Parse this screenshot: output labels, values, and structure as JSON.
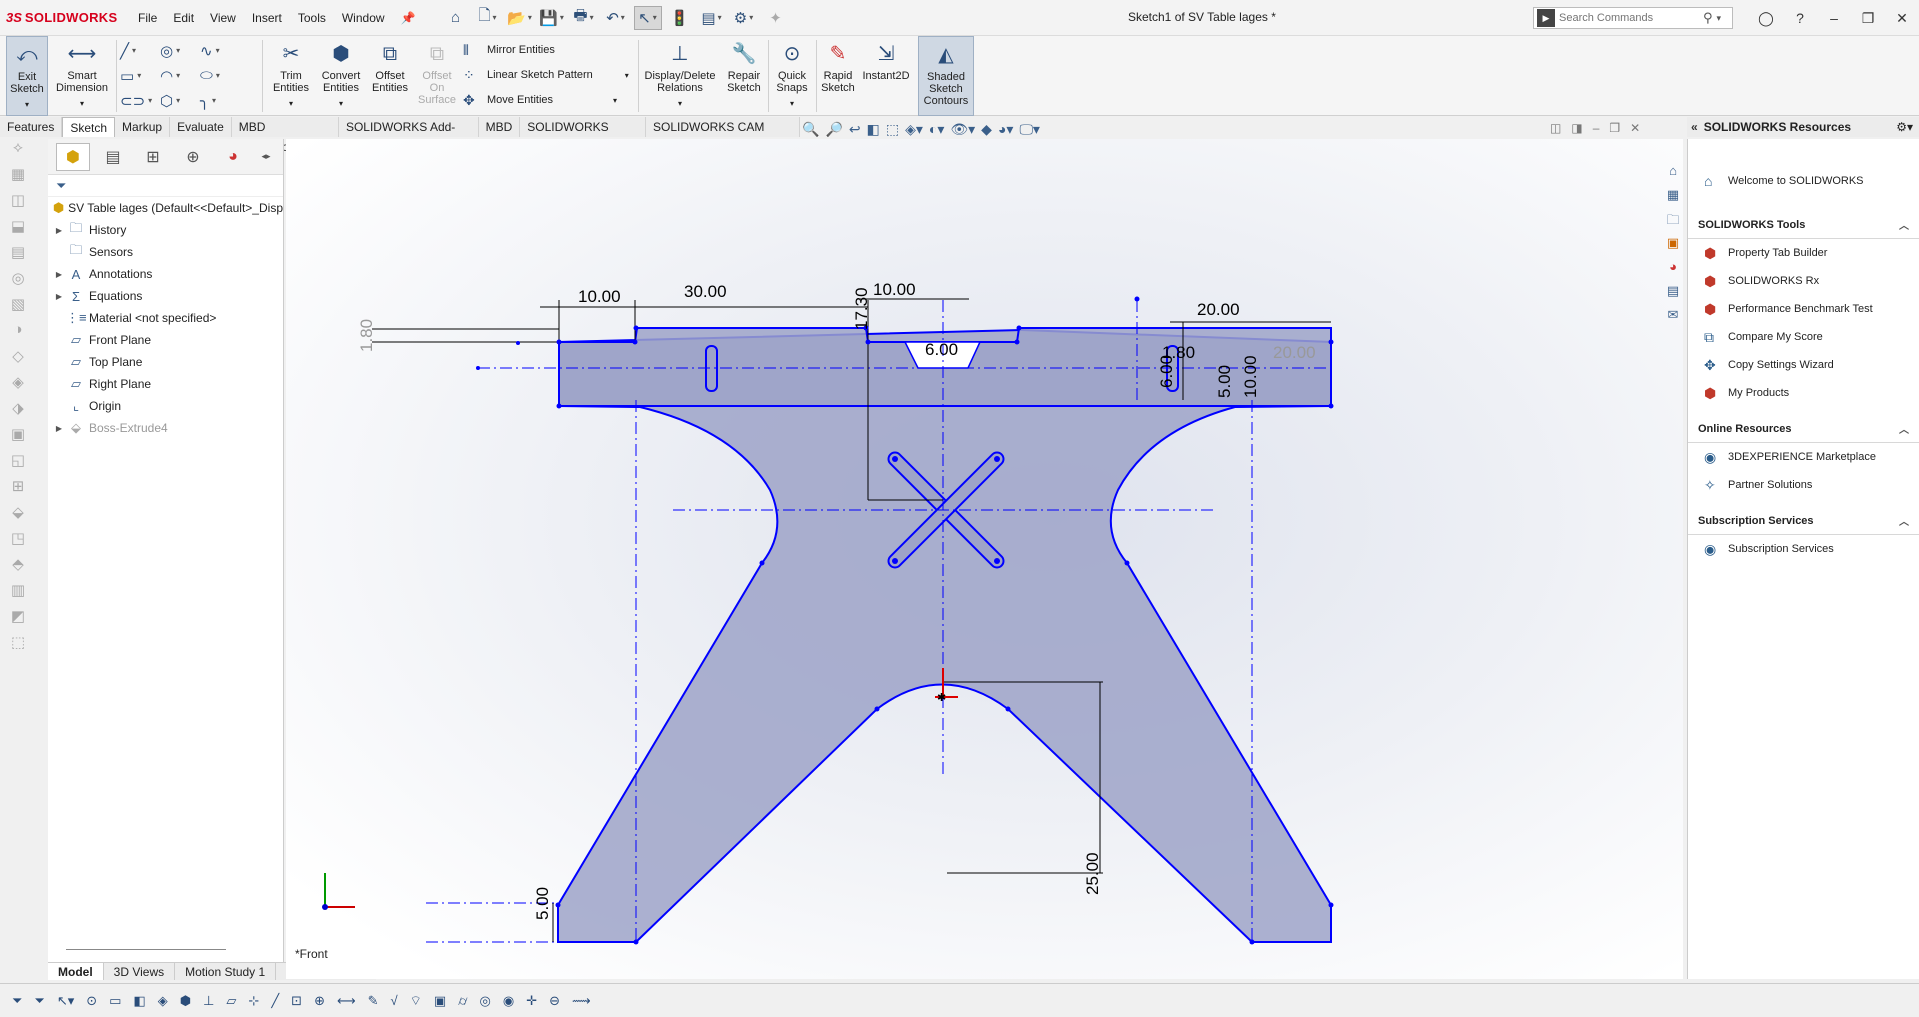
{
  "app": {
    "brand_prefix": "3S",
    "brand_name": "SOLIDWORKS",
    "doc_title": "Sketch1 of SV Table lages *"
  },
  "menu": [
    "File",
    "Edit",
    "View",
    "Insert",
    "Tools",
    "Window"
  ],
  "search": {
    "placeholder": "Search Commands"
  },
  "commands": {
    "exit_sketch": "Exit Sketch",
    "smart_dimension": "Smart Dimension",
    "trim_entities": "Trim Entities",
    "convert_entities": "Convert Entities",
    "offset_entities": "Offset Entities",
    "offset_on_surface": "Offset On Surface",
    "mirror_entities": "Mirror Entities",
    "linear_sketch_pattern": "Linear Sketch Pattern",
    "move_entities": "Move Entities",
    "display_delete_relations": "Display/Delete Relations",
    "repair_sketch": "Repair Sketch",
    "quick_snaps": "Quick Snaps",
    "rapid_sketch": "Rapid Sketch",
    "instant2d": "Instant2D",
    "shaded_sketch_contours": "Shaded Sketch Contours"
  },
  "tabs": [
    "Features",
    "Sketch",
    "Markup",
    "Evaluate",
    "MBD Dimensions",
    "SOLIDWORKS Add-Ins",
    "MBD",
    "SOLIDWORKS CAM",
    "SOLIDWORKS CAM TBM"
  ],
  "active_tab": "Sketch",
  "feature_tree": {
    "root": "SV Table lages  (Default<<Default>_Disp",
    "items": [
      {
        "label": "History",
        "expandable": true
      },
      {
        "label": "Sensors",
        "expandable": false
      },
      {
        "label": "Annotations",
        "expandable": true
      },
      {
        "label": "Equations",
        "expandable": true
      },
      {
        "label": "Material <not specified>",
        "expandable": false
      },
      {
        "label": "Front Plane",
        "expandable": false
      },
      {
        "label": "Top Plane",
        "expandable": false
      },
      {
        "label": "Right Plane",
        "expandable": false
      },
      {
        "label": "Origin",
        "expandable": false
      },
      {
        "label": "Boss-Extrude4",
        "expandable": true
      }
    ]
  },
  "bottom_tabs": [
    "Model",
    "3D Views",
    "Motion Study 1"
  ],
  "view_label": "*Front",
  "dimensions": {
    "d1": "10.00",
    "d2": "30.00",
    "d3": "10.00",
    "d4": "17.30",
    "d5": "1.80",
    "d6": "6.00",
    "d7": "20.00",
    "d8": "20.00",
    "d9": "1.80",
    "d10": "6.00",
    "d11": "5.00",
    "d12": "10.00",
    "d13": "25.00",
    "d14": "5.00"
  },
  "task_pane": {
    "title": "SOLIDWORKS Resources",
    "welcome": "Welcome to SOLIDWORKS",
    "sections": [
      {
        "title": "SOLIDWORKS Tools",
        "items": [
          "Property Tab Builder",
          "SOLIDWORKS Rx",
          "Performance Benchmark Test",
          "Compare My Score",
          "Copy Settings Wizard",
          "My Products"
        ]
      },
      {
        "title": "Online Resources",
        "items": [
          "3DEXPERIENCE Marketplace",
          "Partner Solutions"
        ]
      },
      {
        "title": "Subscription Services",
        "items": [
          "Subscription Services"
        ]
      }
    ]
  },
  "colors": {
    "sketch_line": "#0000ff",
    "sketch_fill": "#9ea3c8",
    "background_top": "#ffffff",
    "background_bottom": "#dfe3ee",
    "brand_red": "#d6001c"
  }
}
